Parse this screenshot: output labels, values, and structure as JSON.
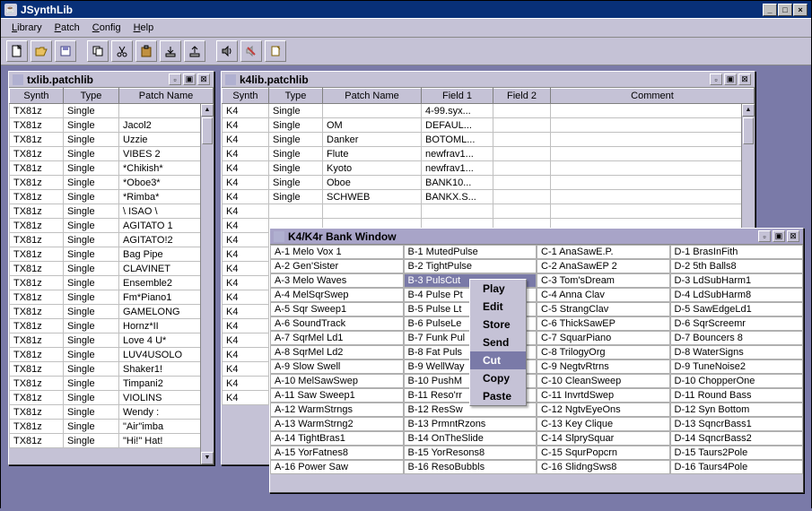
{
  "app": {
    "title": "JSynthLib"
  },
  "menu": {
    "library": "Library",
    "patch": "Patch",
    "config": "Config",
    "help": "Help"
  },
  "toolbar": {
    "icons": [
      "new",
      "open",
      "save",
      "copy",
      "cut",
      "paste",
      "download",
      "upload",
      "sound",
      "edit",
      "props"
    ]
  },
  "windows": {
    "txlib": {
      "title": "txlib.patchlib",
      "columns": [
        "Synth",
        "Type",
        "Patch Name"
      ],
      "rows": [
        [
          "TX81z",
          "Single",
          ""
        ],
        [
          "TX81z",
          "Single",
          " Jacol2"
        ],
        [
          "TX81z",
          "Single",
          " Uzzie"
        ],
        [
          "TX81z",
          "Single",
          " VIBES 2"
        ],
        [
          "TX81z",
          "Single",
          "*Chikish*"
        ],
        [
          "TX81z",
          "Single",
          "*Oboe3*"
        ],
        [
          "TX81z",
          "Single",
          "*Rimba*"
        ],
        [
          "TX81z",
          "Single",
          "\\ ISAO \\"
        ],
        [
          "TX81z",
          "Single",
          "AGITATO 1"
        ],
        [
          "TX81z",
          "Single",
          "AGITATO!2"
        ],
        [
          "TX81z",
          "Single",
          "Bag Pipe"
        ],
        [
          "TX81z",
          "Single",
          "CLAVINET"
        ],
        [
          "TX81z",
          "Single",
          "Ensemble2"
        ],
        [
          "TX81z",
          "Single",
          "Fm*Piano1"
        ],
        [
          "TX81z",
          "Single",
          "GAMELONG"
        ],
        [
          "TX81z",
          "Single",
          "Hornz*II"
        ],
        [
          "TX81z",
          "Single",
          "Love 4 U*"
        ],
        [
          "TX81z",
          "Single",
          "LUV4USOLO"
        ],
        [
          "TX81z",
          "Single",
          "Shaker1!"
        ],
        [
          "TX81z",
          "Single",
          "Timpani2"
        ],
        [
          "TX81z",
          "Single",
          "VIOLINS"
        ],
        [
          "TX81z",
          "Single",
          "Wendy :"
        ],
        [
          "TX81z",
          "Single",
          "\"Air\"imba"
        ],
        [
          "TX81z",
          "Single",
          "\"Hi!\" Hat!"
        ]
      ]
    },
    "k4lib": {
      "title": "k4lib.patchlib",
      "columns": [
        "Synth",
        "Type",
        "Patch Name",
        "Field 1",
        "Field 2",
        "Comment"
      ],
      "rows": [
        [
          "K4",
          "Single",
          "",
          "4-99.syx...",
          "",
          ""
        ],
        [
          "K4",
          "Single",
          "OM",
          "DEFAUL...",
          "",
          ""
        ],
        [
          "K4",
          "Single",
          "Danker",
          "BOTOML...",
          "",
          ""
        ],
        [
          "K4",
          "Single",
          "Flute",
          "newfrav1...",
          "",
          ""
        ],
        [
          "K4",
          "Single",
          "Kyoto",
          "newfrav1...",
          "",
          ""
        ],
        [
          "K4",
          "Single",
          "Oboe",
          "BANK10...",
          "",
          ""
        ],
        [
          "K4",
          "Single",
          "SCHWEB",
          "BANKX.S...",
          "",
          ""
        ],
        [
          "K4",
          "",
          "",
          "",
          "",
          ""
        ],
        [
          "K4",
          "",
          "",
          "",
          "",
          ""
        ],
        [
          "K4",
          "",
          "",
          "",
          "",
          ""
        ],
        [
          "K4",
          "",
          "",
          "",
          "",
          ""
        ],
        [
          "K4",
          "",
          "",
          "",
          "",
          ""
        ],
        [
          "K4",
          "",
          "",
          "",
          "",
          ""
        ],
        [
          "K4",
          "",
          "",
          "",
          "",
          ""
        ],
        [
          "K4",
          "",
          "",
          "",
          "",
          ""
        ],
        [
          "K4",
          "",
          "",
          "",
          "",
          ""
        ],
        [
          "K4",
          "",
          "",
          "",
          "",
          ""
        ],
        [
          "K4",
          "",
          "",
          "",
          "",
          ""
        ],
        [
          "K4",
          "",
          "",
          "",
          "",
          ""
        ],
        [
          "K4",
          "",
          "",
          "",
          "",
          ""
        ],
        [
          "K4",
          "",
          "",
          "",
          "",
          ""
        ]
      ]
    },
    "bank": {
      "title": "K4/K4r Bank Window",
      "cells": {
        "A": [
          "A-1 Melo Vox 1",
          "A-2 Gen'Sister",
          "A-3 Melo Waves",
          "A-4 MelSqrSwep",
          "A-5 Sqr Sweep1",
          "A-6 SoundTrack",
          "A-7 SqrMel Ld1",
          "A-8 SqrMel Ld2",
          "A-9 Slow Swell",
          "A-10 MelSawSwep",
          "A-11 Saw Sweep1",
          "A-12 WarmStrngs",
          "A-13 WarmStrng2",
          "A-14 TightBras1",
          "A-15 YorFatnes8",
          "A-16 Power Saw"
        ],
        "B": [
          "B-1 MutedPulse",
          "B-2 TightPulse",
          "B-3 PulsCut",
          "B-4 Pulse Pt",
          "B-5 Pulse Lt",
          "B-6 PulseLe",
          "B-7 Funk Pul",
          "B-8 Fat Puls",
          "B-9 WellWay",
          "B-10 PushM",
          "B-11 Reso'rr",
          "B-12 ResSw",
          "B-13 PrmntRzons",
          "B-14 OnTheSlide",
          "B-15 YorResons8",
          "B-16 ResoBubbls"
        ],
        "C": [
          "C-1 AnaSawE.P.",
          "C-2 AnaSawEP 2",
          "C-3 Tom'sDream",
          "C-4 Anna Clav",
          "C-5 StrangClav",
          "C-6 ThickSawEP",
          "C-7 SquarPiano",
          "C-8 TrilogyOrg",
          "C-9 NegtvRtrns",
          "C-10 CleanSweep",
          "C-11 InvrtdSwep",
          "C-12 NgtvEyeOns",
          "C-13 Key Clique",
          "C-14 SlprySquar",
          "C-15 SqurPopcrn",
          "C-16 SlidngSws8"
        ],
        "D": [
          "D-1 BrasInFith",
          "D-2 5th Balls8",
          "D-3 LdSubHarm1",
          "D-4 LdSubHarm8",
          "D-5 SawEdgeLd1",
          "D-6 SqrScreemr",
          "D-7 Bouncers 8",
          "D-8 WaterSigns",
          "D-9 TuneNoise2",
          "D-10 ChopperOne",
          "D-11 Round Bass",
          "D-12 Syn Bottom",
          "D-13 SqncrBass1",
          "D-14 SqncrBass2",
          "D-15 Taurs2Pole",
          "D-16 Taurs4Pole"
        ]
      },
      "selected": {
        "col": "B",
        "row": 2
      }
    }
  },
  "context_menu": {
    "items": [
      "Play",
      "Edit",
      "Store",
      "Send",
      "Cut",
      "Copy",
      "Paste"
    ],
    "highlighted": 4
  }
}
